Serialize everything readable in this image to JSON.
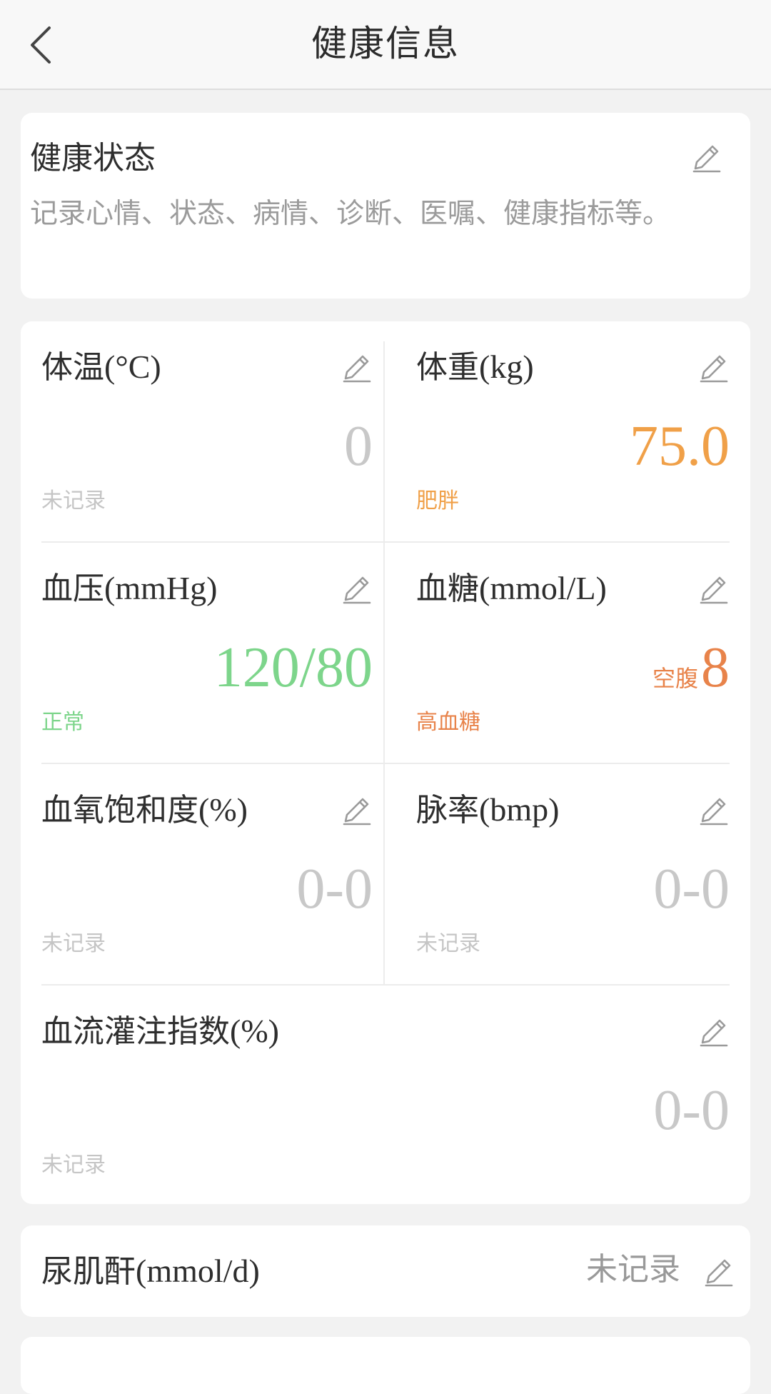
{
  "nav": {
    "title": "健康信息",
    "back_icon": "chevron-left-icon"
  },
  "status": {
    "title": "健康状态",
    "description": "记录心情、状态、病情、诊断、医嘱、健康指标等。"
  },
  "metrics": [
    {
      "label_cn": "体温",
      "label_unit": "(°C)",
      "value_prefix": "",
      "value": "0",
      "status": "未记录",
      "value_color": "#c8c8c8",
      "status_color": "#c5c5c5"
    },
    {
      "label_cn": "体重",
      "label_unit": "(kg)",
      "value_prefix": "",
      "value": "75.0",
      "status": "肥胖",
      "value_color": "#f0a048",
      "status_color": "#f0a048"
    },
    {
      "label_cn": "血压",
      "label_unit": "(mmHg)",
      "value_prefix": "",
      "value": "120/80",
      "status": "正常",
      "value_color": "#7dd58b",
      "status_color": "#7dd58b"
    },
    {
      "label_cn": "血糖",
      "label_unit": "(mmol/L)",
      "value_prefix": "空腹",
      "value": "8",
      "status": "高血糖",
      "value_color": "#e8834a",
      "status_color": "#e8834a"
    },
    {
      "label_cn": "血氧饱和度",
      "label_unit": "(%)",
      "value_prefix": "",
      "value": "0-0",
      "status": "未记录",
      "value_color": "#c8c8c8",
      "status_color": "#c5c5c5"
    },
    {
      "label_cn": "脉率",
      "label_unit": "(bmp)",
      "value_prefix": "",
      "value": "0-0",
      "status": "未记录",
      "value_color": "#c8c8c8",
      "status_color": "#c5c5c5"
    },
    {
      "label_cn": "血流灌注指数",
      "label_unit": "(%)",
      "value_prefix": "",
      "value": "0-0",
      "status": "未记录",
      "value_color": "#c8c8c8",
      "status_color": "#c5c5c5"
    }
  ],
  "rows": [
    {
      "label_cn": "尿肌酐",
      "label_unit": "(mmol/d)",
      "value": "未记录"
    }
  ],
  "icons": {
    "edit": "pencil-icon"
  }
}
